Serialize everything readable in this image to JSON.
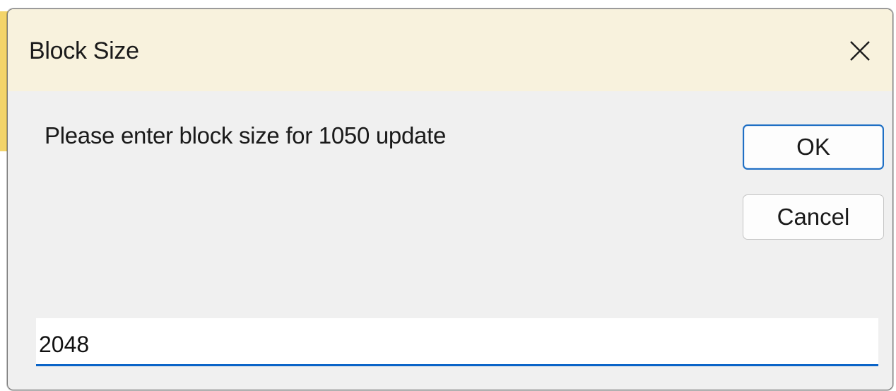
{
  "dialog": {
    "title": "Block Size",
    "close_glyph": "close-icon",
    "prompt": "Please enter block size for 1050 update",
    "ok_label": "OK",
    "cancel_label": "Cancel",
    "input_value": "2048"
  },
  "colors": {
    "accent": "#0a64c8",
    "dialog_bg": "#f0f0f0",
    "titlebar_bg": "#f8f2dd"
  }
}
